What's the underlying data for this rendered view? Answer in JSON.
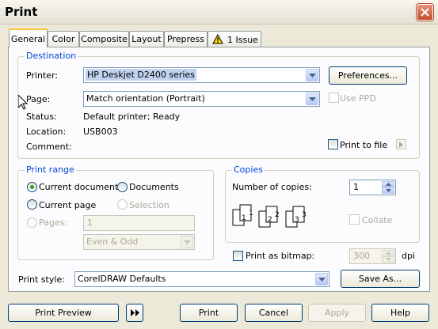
{
  "window": {
    "title": "Print"
  },
  "tabs": [
    {
      "label": "General"
    },
    {
      "label": "Color"
    },
    {
      "label": "Composite"
    },
    {
      "label": "Layout"
    },
    {
      "label": "Prepress"
    },
    {
      "label": "1 Issue",
      "icon": "warning-icon"
    }
  ],
  "destination": {
    "legend": "Destination",
    "printer_label": "Printer:",
    "printer_value": "HP Deskjet D2400 series",
    "preferences_button": "Preferences...",
    "page_label": "Page:",
    "page_value": "Match orientation (Portrait)",
    "use_ppd_label": "Use PPD",
    "status_label": "Status:",
    "status_value": "Default printer; Ready",
    "location_label": "Location:",
    "location_value": "USB003",
    "comment_label": "Comment:",
    "print_to_file_label": "Print to file"
  },
  "print_range": {
    "legend": "Print range",
    "current_document": "Current document",
    "documents": "Documents",
    "current_page": "Current page",
    "selection": "Selection",
    "pages_label": "Pages:",
    "pages_value": "1",
    "page_set_value": "Even & Odd"
  },
  "copies": {
    "legend": "Copies",
    "number_label": "Number of copies:",
    "number_value": "1",
    "collate_label": "Collate",
    "collate_icon_labels": [
      "1",
      "1",
      "2",
      "2",
      "3",
      "3"
    ]
  },
  "bitmap": {
    "label": "Print as bitmap:",
    "dpi_value": "300",
    "dpi_unit": "dpi"
  },
  "print_style": {
    "label": "Print style:",
    "value": "CorelDRAW Defaults",
    "save_as_button": "Save As..."
  },
  "footer": {
    "print_preview": "Print Preview",
    "print": "Print",
    "cancel": "Cancel",
    "apply": "Apply",
    "help": "Help"
  },
  "colors": {
    "legend_blue": "#0046d5",
    "title_bar": "#ece9d8",
    "close_red": "#c84c26",
    "radio_green": "#21a121"
  }
}
